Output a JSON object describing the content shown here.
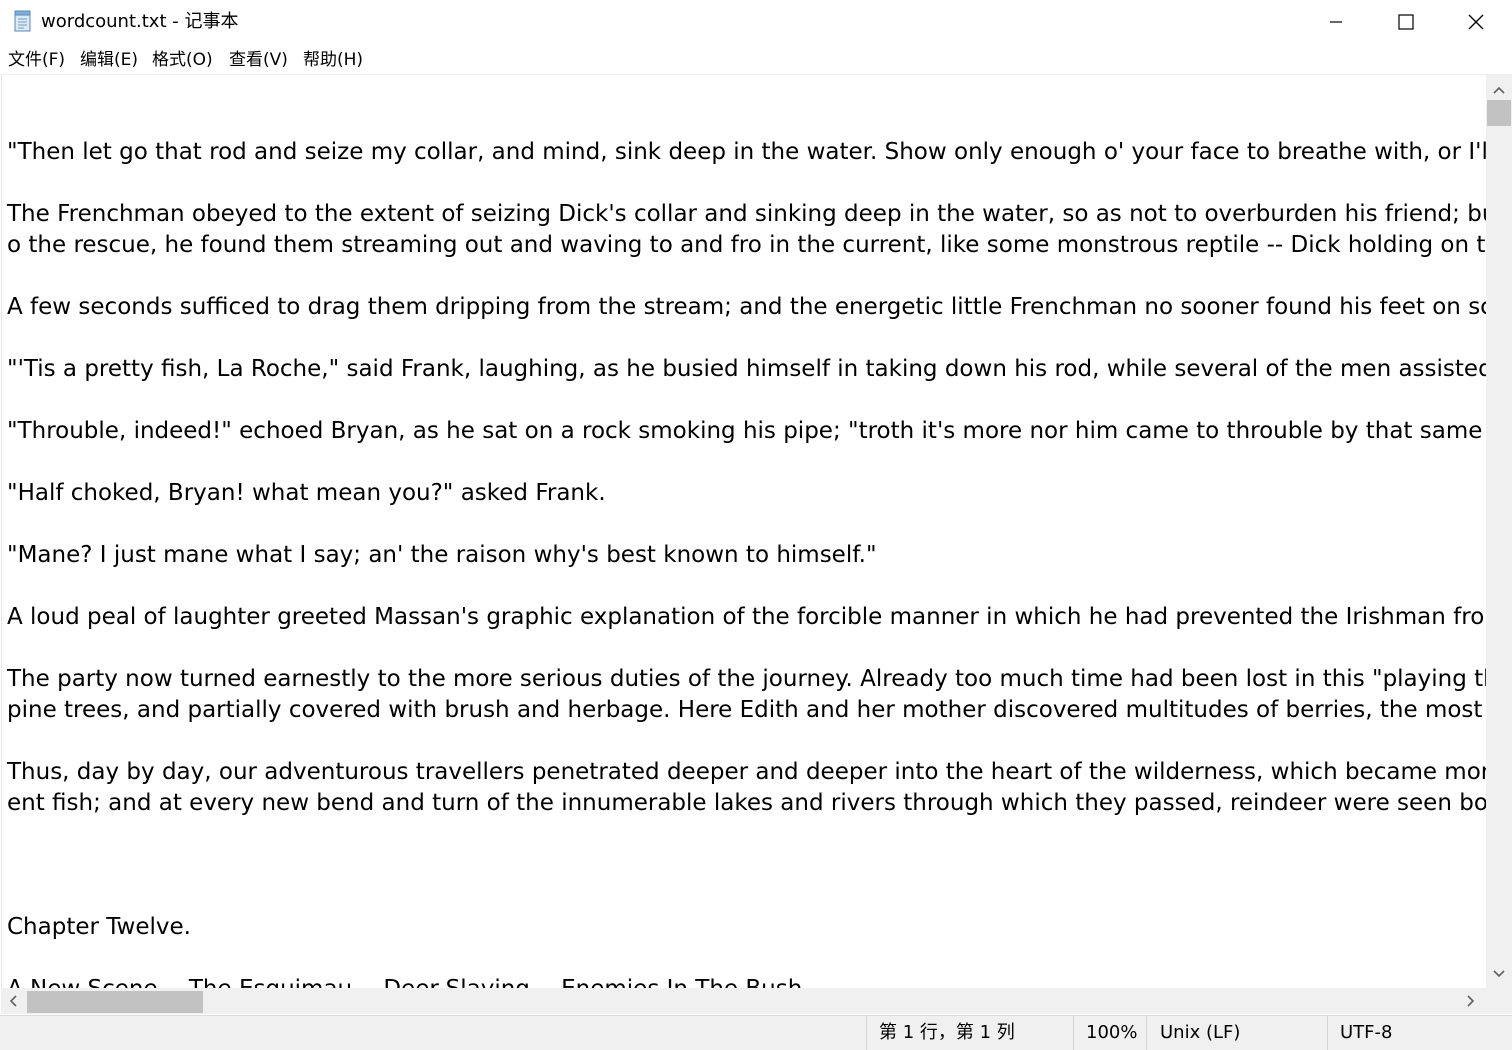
{
  "window": {
    "title": "wordcount.txt - 记事本",
    "icon": "notepad-icon",
    "controls": [
      "minimize-icon",
      "maximize-icon",
      "close-icon"
    ]
  },
  "menu": {
    "file": "文件(F)",
    "edit": "编辑(E)",
    "format": "格式(O)",
    "view": "查看(V)",
    "help": "帮助(H)"
  },
  "editor": {
    "lines": [
      "\"Then let go that rod and seize my collar, and mind, sink deep in the water. Show only enough o' your face to breathe with, or I'll",
      "The Frenchman obeyed to the extent of seizing Dick's collar and sinking deep in the water, so as not to overburden his friend; bu",
      "o the rescue, he found them streaming out and waving to and fro in the current, like some monstrous reptile -- Dick holding on t",
      "A few seconds sufficed to drag them dripping from the stream; and the energetic little Frenchman no sooner found his feet on sc",
      "\"'Tis a pretty fish, La Roche,\" said Frank, laughing, as he busied himself in taking down his rod, while several of the men assisted D",
      "\"Throuble, indeed!\" echoed Bryan, as he sat on a rock smoking his pipe; \"troth it's more nor him came to throuble by that same fi",
      "\"Half choked, Bryan! what mean you?\" asked Frank.",
      "\"Mane? I just mane what I say; an' the raison why's best known to himself.\"",
      "A loud peal of laughter greeted Massan's graphic explanation of the forcible manner in which he had prevented the Irishman fror",
      "The party now turned earnestly to the more serious duties of the journey. Already too much time had been lost in this \"playing th",
      "pine trees, and partially covered with brush and herbage. Here Edith and her mother discovered multitudes of berries, the most r",
      "Thus, day by day, our adventurous travellers penetrated deeper and deeper into the heart of the wilderness, which became more",
      "ent fish; and at every new bend and turn of the innumerable lakes and rivers through which they passed, reindeer were seen bou",
      "Chapter Twelve.",
      "A New Scene -- The Esquimau -- Deer-Slaying -- Enemies In The Bush."
    ]
  },
  "statusbar": {
    "position": "第 1 行，第 1 列",
    "zoom": "100%",
    "line_ending": "Unix (LF)",
    "encoding": "UTF-8"
  },
  "colors": {
    "chrome": "#f0f0f0",
    "scroll_thumb": "#c2c2c2",
    "text": "#000000"
  }
}
